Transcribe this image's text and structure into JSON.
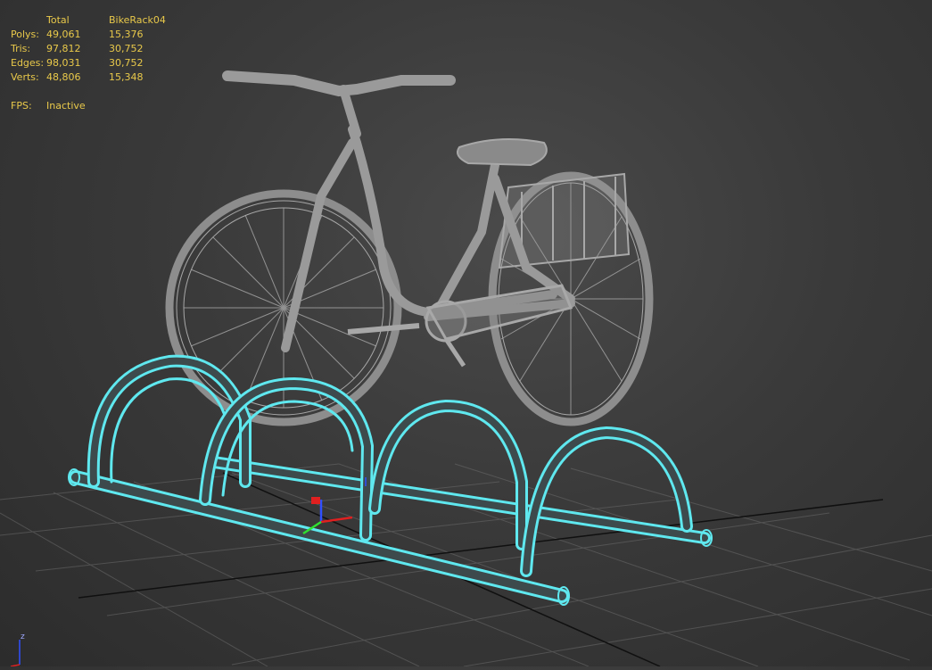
{
  "stats": {
    "header_total": "Total",
    "header_object": "BikeRack04",
    "rows": [
      {
        "label": "Polys:",
        "total": "49,061",
        "object": "15,376"
      },
      {
        "label": "Tris:",
        "total": "97,812",
        "object": "30,752"
      },
      {
        "label": "Edges:",
        "total": "98,031",
        "object": "30,752"
      },
      {
        "label": "Verts:",
        "total": "48,806",
        "object": "15,348"
      }
    ],
    "fps_label": "FPS:",
    "fps_value": "Inactive"
  },
  "axis": {
    "z_label": "z"
  },
  "colors": {
    "background": "#3a3a3a",
    "stats_text": "#e9c94a",
    "grid": "#6b6b6b",
    "grid_main": "#101010",
    "bike_wire": "#a8a8a8",
    "selection_wire": "#5fe8ef",
    "gizmo_x": "#e02020",
    "gizmo_y": "#30e030",
    "gizmo_z": "#3050ff"
  }
}
